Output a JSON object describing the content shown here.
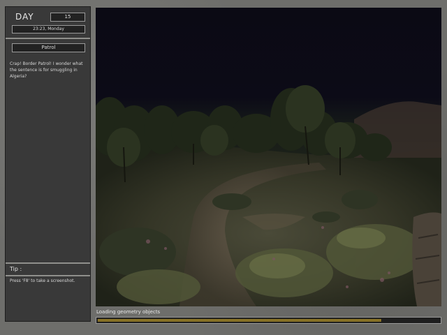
{
  "status": {
    "day_label": "DAY",
    "day_number": "15",
    "time": "23:23, Monday"
  },
  "event": {
    "title": "Patrol",
    "text": "Crap! Border Patrol! I wonder what the sentence is for smuggling in Algeria?"
  },
  "tip": {
    "label": "Tip :",
    "text": "Press 'F8' to take a screenshot."
  },
  "loading": {
    "label": "Loading geometry objects",
    "progress": 0.83
  },
  "colors": {
    "panel_bg": "#393939",
    "progress_fill": "#a0862e"
  }
}
